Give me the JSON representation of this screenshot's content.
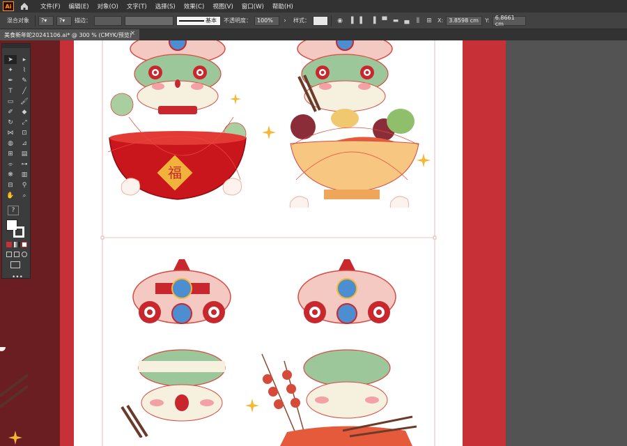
{
  "app": {
    "logo_text": "Ai"
  },
  "menu": [
    "文件(F)",
    "编辑(E)",
    "对象(O)",
    "文字(T)",
    "选择(S)",
    "效果(C)",
    "视图(V)",
    "窗口(W)",
    "帮助(H)"
  ],
  "control_bar": {
    "selection_label": "混合对象",
    "stroke_label": "描边：",
    "stroke_style": "基本",
    "opacity_label": "不透明度：",
    "opacity_value": "100%",
    "style_label": "样式：",
    "x_label": "X:",
    "x_value": "3.8598 cm",
    "y_label": "Y:",
    "y_value": "6.8661 cm"
  },
  "document_tab": {
    "title": "美食新年蛇20241106.ai* @ 300 % (CMYK/预览)",
    "close": "×"
  },
  "colors": {
    "dark_red": "#6a1e22",
    "red": "#c63036",
    "artboard": "#ffffff",
    "selection": "#e8463c"
  },
  "toolbox": {
    "tools": [
      "selection-tool",
      "direct-selection-tool",
      "magic-wand-tool",
      "lasso-tool",
      "pen-tool",
      "curvature-tool",
      "type-tool",
      "line-tool",
      "rectangle-tool",
      "paintbrush-tool",
      "shaper-tool",
      "eraser-tool",
      "rotate-tool",
      "scale-tool",
      "width-tool",
      "free-transform-tool",
      "shape-builder-tool",
      "perspective-tool",
      "mesh-tool",
      "gradient-tool",
      "eyedropper-tool",
      "blend-tool",
      "symbol-sprayer-tool",
      "column-graph-tool",
      "artboard-tool",
      "slice-tool",
      "hand-tool",
      "zoom-tool"
    ],
    "help_glyph": "?",
    "more": "•••"
  },
  "artwork": {
    "bowl_charm": "福"
  }
}
